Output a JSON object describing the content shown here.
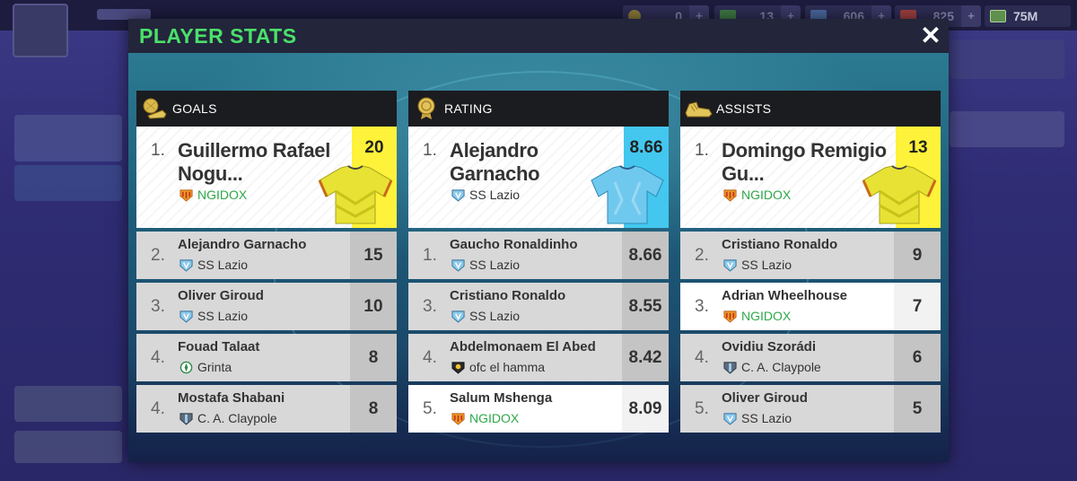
{
  "modal": {
    "title": "PLAYER STATS",
    "close_label": "✕"
  },
  "header": {
    "resources": [
      {
        "value": "0",
        "icon": "ball-icon"
      },
      {
        "value": "13",
        "icon": "cash-icon"
      },
      {
        "value": "606",
        "icon": "ticket-icon"
      },
      {
        "value": "825",
        "icon": "gem-icon"
      },
      {
        "value": "75M",
        "icon": "money-icon"
      }
    ]
  },
  "colors": {
    "title_green": "#4be06a",
    "yellow_box": "#fff23a",
    "blue_box": "#43c7ef",
    "team_green": "#2ea84a"
  },
  "columns": [
    {
      "label": "GOALS",
      "icon": "golden-ball-boot-icon",
      "top": {
        "rank": "1.",
        "name": "Guillermo Rafael Nogu...",
        "team": "NGIDOX",
        "team_badge": "ngidox",
        "value": "20",
        "shirt": "yellow"
      },
      "rows": [
        {
          "rank": "2.",
          "name": "Alejandro Garnacho",
          "team": "SS Lazio",
          "team_badge": "lazio",
          "value": "15",
          "highlight": false
        },
        {
          "rank": "3.",
          "name": "Oliver Giroud",
          "team": "SS Lazio",
          "team_badge": "lazio",
          "value": "10",
          "highlight": false
        },
        {
          "rank": "4.",
          "name": "Fouad Talaat",
          "team": "Grinta",
          "team_badge": "grinta",
          "value": "8",
          "highlight": false
        },
        {
          "rank": "4.",
          "name": "Mostafa Shabani",
          "team": "C. A. Claypole",
          "team_badge": "claypole",
          "value": "8",
          "highlight": false
        }
      ]
    },
    {
      "label": "RATING",
      "icon": "gold-medal-icon",
      "top": {
        "rank": "1.",
        "name": "Alejandro Garnacho",
        "team": "SS Lazio",
        "team_badge": "lazio",
        "value": "8.66",
        "shirt": "blue"
      },
      "rows": [
        {
          "rank": "1.",
          "name": "Gaucho Ronaldinho",
          "team": "SS Lazio",
          "team_badge": "lazio",
          "value": "8.66",
          "highlight": false
        },
        {
          "rank": "3.",
          "name": "Cristiano Ronaldo",
          "team": "SS Lazio",
          "team_badge": "lazio",
          "value": "8.55",
          "highlight": false
        },
        {
          "rank": "4.",
          "name": "Abdelmonaem El Abed",
          "team": "ofc el hamma",
          "team_badge": "hamma",
          "value": "8.42",
          "highlight": false
        },
        {
          "rank": "5.",
          "name": "Salum Mshenga",
          "team": "NGIDOX",
          "team_badge": "ngidox",
          "value": "8.09",
          "highlight": true
        }
      ]
    },
    {
      "label": "ASSISTS",
      "icon": "golden-boot-icon",
      "top": {
        "rank": "1.",
        "name": "Domingo Remigio Gu...",
        "team": "NGIDOX",
        "team_badge": "ngidox",
        "value": "13",
        "shirt": "yellow"
      },
      "rows": [
        {
          "rank": "2.",
          "name": "Cristiano Ronaldo",
          "team": "SS Lazio",
          "team_badge": "lazio",
          "value": "9",
          "highlight": false
        },
        {
          "rank": "3.",
          "name": "Adrian Wheelhouse",
          "team": "NGIDOX",
          "team_badge": "ngidox",
          "value": "7",
          "highlight": true
        },
        {
          "rank": "4.",
          "name": "Ovidiu Szorádi",
          "team": "C. A. Claypole",
          "team_badge": "claypole",
          "value": "6",
          "highlight": false
        },
        {
          "rank": "5.",
          "name": "Oliver Giroud",
          "team": "SS Lazio",
          "team_badge": "lazio",
          "value": "5",
          "highlight": false
        }
      ]
    }
  ]
}
